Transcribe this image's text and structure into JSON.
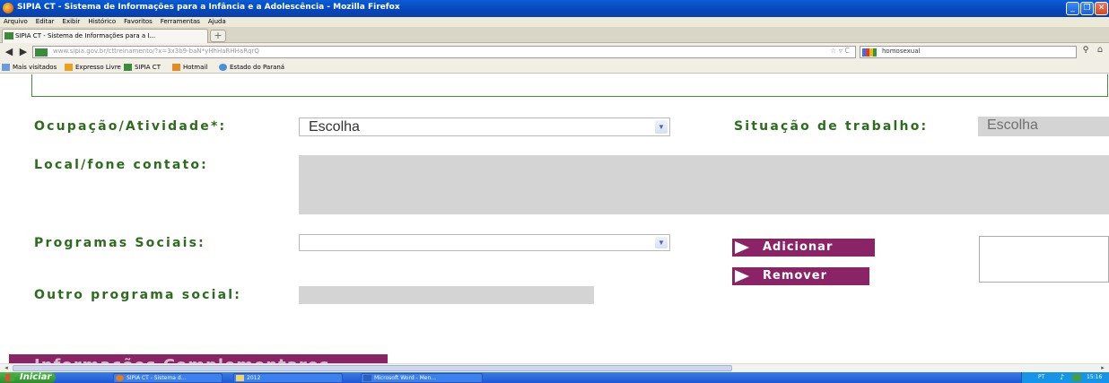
{
  "window": {
    "title": "SIPIA CT - Sistema de Informações para a Infância e a Adolescência - Mozilla Firefox"
  },
  "menu": [
    "Arquivo",
    "Editar",
    "Exibir",
    "Histórico",
    "Favoritos",
    "Ferramentas",
    "Ajuda"
  ],
  "tab": {
    "label": "SIPIA CT - Sistema de Informações para a I...",
    "new_tab": "+"
  },
  "nav": {
    "url": "www.sipia.gov.br/cttreinamento/?x=3x3b9-baN*yHhHaRHHaRqrQ",
    "search_value": "homosexual"
  },
  "bookmarks": [
    "Mais visitados",
    "Expresso Livre",
    "SIPIA CT",
    "Hotmail",
    "Estado do Paraná"
  ],
  "form": {
    "ocupacao_label": "Ocupação/Atividade*:",
    "ocupacao_value": "Escolha",
    "situacao_label": "Situação de trabalho:",
    "situacao_value": "Escolha",
    "local_label": "Local/fone contato:",
    "programas_label": "Programas Sociais:",
    "programas_value": "",
    "adicionar_label": "Adicionar",
    "remover_label": "Remover",
    "outro_label": "Outro programa social:",
    "section_title": "Informações Complementares"
  },
  "taskbar": {
    "start": "Iniciar",
    "tasks": [
      "SIPIA CT - Sistema d...",
      "2012",
      "Microsoft Word - Men..."
    ],
    "tray_lang": "PT",
    "clock": "15:16"
  },
  "colors": {
    "label_green": "#2b6d1c",
    "button_purple": "#8b2467",
    "field_gray": "#d4d4d4"
  }
}
